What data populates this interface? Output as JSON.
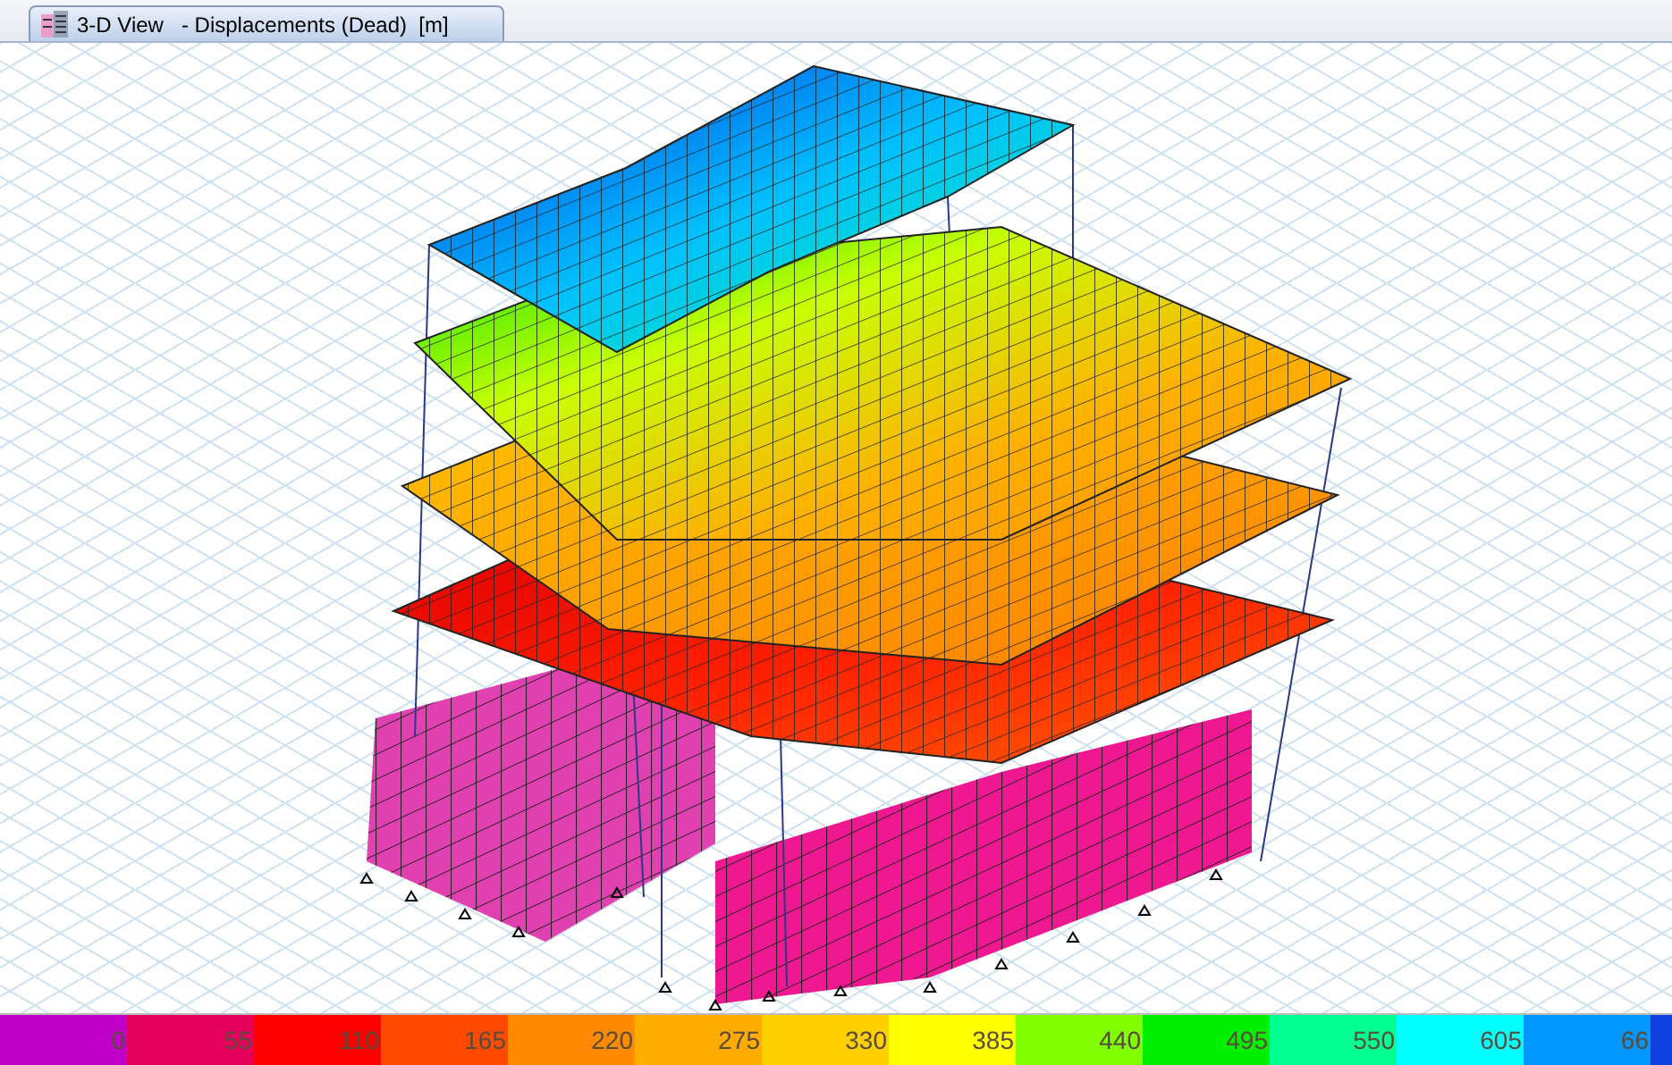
{
  "tab": {
    "title": "3-D View   - Displacements (Dead)  [m]",
    "selected": true
  },
  "legend": [
    {
      "label": "0",
      "color": "#c000c8"
    },
    {
      "label": "55",
      "color": "#e6005c"
    },
    {
      "label": "110",
      "color": "#ff0000"
    },
    {
      "label": "165",
      "color": "#ff4a00"
    },
    {
      "label": "220",
      "color": "#ff8a00"
    },
    {
      "label": "275",
      "color": "#ffab00"
    },
    {
      "label": "330",
      "color": "#ffd000"
    },
    {
      "label": "385",
      "color": "#ffff00"
    },
    {
      "label": "440",
      "color": "#80ff00"
    },
    {
      "label": "495",
      "color": "#00f000"
    },
    {
      "label": "550",
      "color": "#00ff90"
    },
    {
      "label": "605",
      "color": "#00ffff"
    },
    {
      "label": "66",
      "color": "#0098ff"
    },
    {
      "color": "#1040e0"
    }
  ]
}
